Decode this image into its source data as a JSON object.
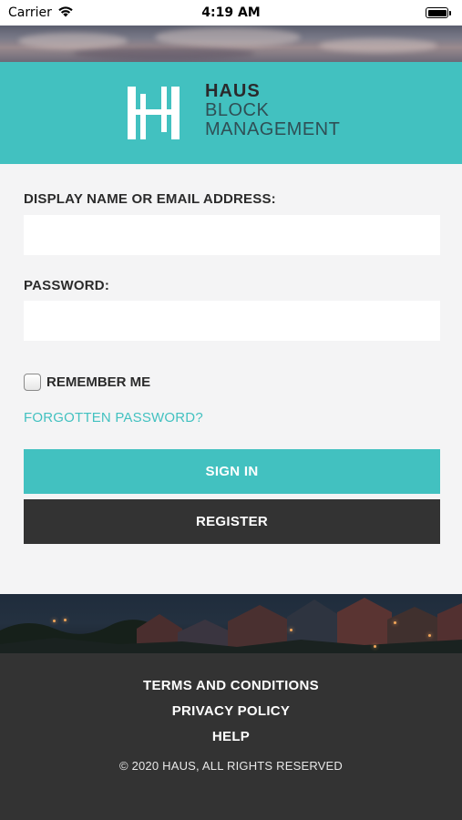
{
  "status_bar": {
    "carrier": "Carrier",
    "time": "4:19 AM"
  },
  "brand": {
    "name": "HAUS",
    "line1": "BLOCK",
    "line2": "MANAGEMENT",
    "accent_color": "#42c1c0",
    "dark_color": "#333333"
  },
  "form": {
    "username_label": "DISPLAY NAME OR EMAIL ADDRESS:",
    "username_value": "",
    "password_label": "PASSWORD:",
    "password_value": "",
    "remember_label": "REMEMBER ME",
    "remember_checked": false,
    "forgot_label": "FORGOTTEN PASSWORD?",
    "signin_label": "SIGN IN",
    "register_label": "REGISTER"
  },
  "footer": {
    "terms": "TERMS AND CONDITIONS",
    "privacy": "PRIVACY POLICY",
    "help": "HELP",
    "copyright": "© 2020 HAUS, ALL RIGHTS RESERVED"
  }
}
